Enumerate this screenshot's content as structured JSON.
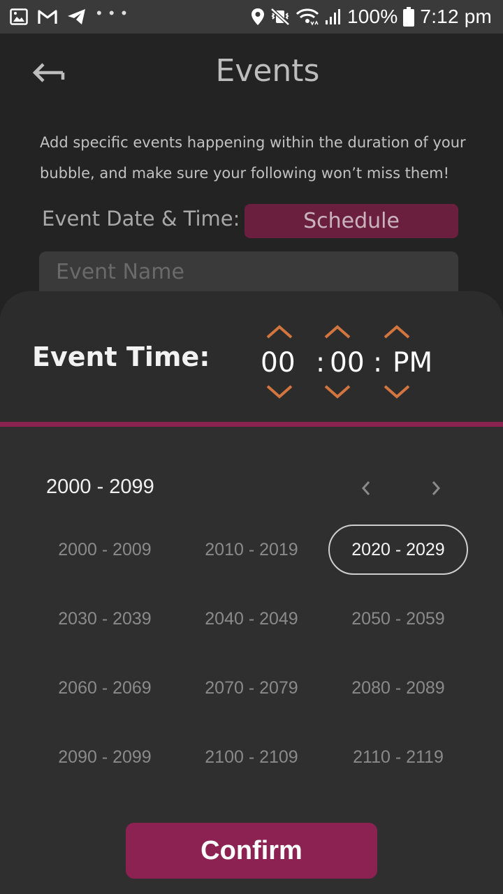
{
  "status_bar": {
    "battery": "100%",
    "time": "7:12 pm",
    "icons": [
      "image-icon",
      "gmail-icon",
      "telegram-icon",
      "more-dots-icon",
      "location-icon",
      "mute-vibrate-icon",
      "wifi-icon",
      "signal-icon",
      "battery-icon"
    ]
  },
  "header": {
    "title": "Events"
  },
  "description": "Add specific events happening within the duration of your bubble, and make sure your following won’t miss them!",
  "event_date": {
    "label": "Event Date & Time:",
    "button": "Schedule"
  },
  "event_name": {
    "placeholder": "Event Name"
  },
  "time_picker": {
    "label": "Event Time:",
    "hour": "00",
    "separator1": ":",
    "minute": "00",
    "separator2": ":",
    "period": "PM",
    "accent_color": "#d2753f",
    "divider_color": "#8a2350"
  },
  "calendar": {
    "range": "2000 - 2099",
    "decades": [
      "2000 - 2009",
      "2010 - 2019",
      "2020 - 2029",
      "2030 - 2039",
      "2040 - 2049",
      "2050 - 2059",
      "2060 - 2069",
      "2070 - 2079",
      "2080 - 2089",
      "2090 - 2099",
      "2100 - 2109",
      "2110 - 2119"
    ],
    "selected": "2020 - 2029"
  },
  "confirm": {
    "label": "Confirm",
    "color": "#8c2252"
  }
}
